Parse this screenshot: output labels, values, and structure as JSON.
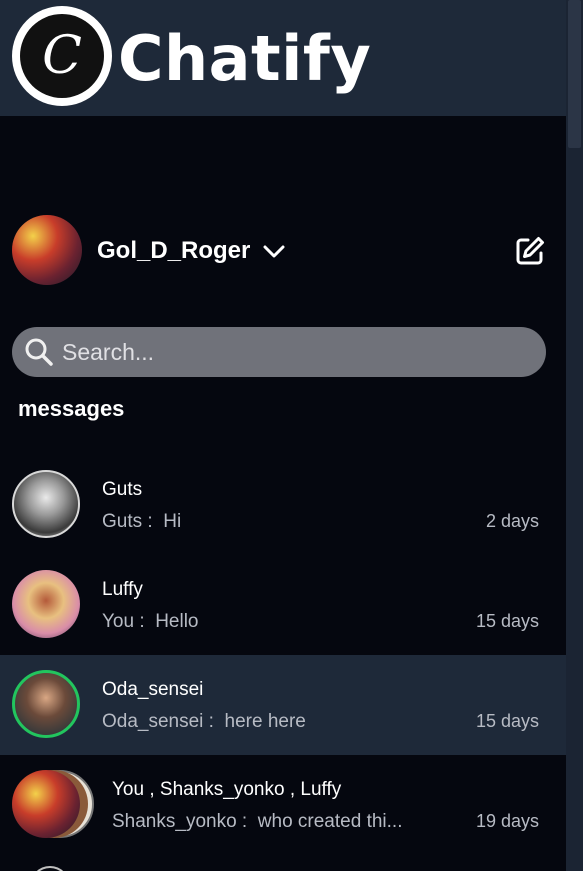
{
  "app": {
    "title": "Chatify",
    "logo_letter": "C"
  },
  "user": {
    "username": "Gol_D_Roger"
  },
  "search": {
    "placeholder": "Search..."
  },
  "section": {
    "label": "messages"
  },
  "conversations": [
    {
      "title": "Guts",
      "sender": "Guts",
      "message": "Hi",
      "time": "2 days",
      "active": false
    },
    {
      "title": "Luffy",
      "sender": "You",
      "message": "Hello",
      "time": "15 days",
      "active": false
    },
    {
      "title": "Oda_sensei",
      "sender": "Oda_sensei",
      "message": "here here",
      "time": "15 days",
      "active": true,
      "online": true
    },
    {
      "title": "You , Shanks_yonko , Luffy",
      "sender": "Shanks_yonko",
      "message": "who created thi...",
      "time": "19 days",
      "active": false,
      "group": true
    }
  ],
  "colors": {
    "background": "#05070f",
    "header": "#1e2939",
    "search_bg": "#70727a",
    "online_ring": "#22c55e",
    "muted_text": "#b7bbc4"
  }
}
